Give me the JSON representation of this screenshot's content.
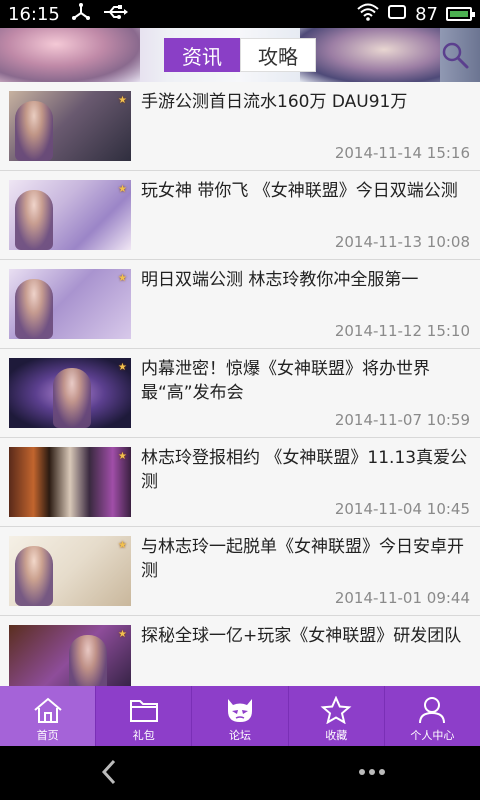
{
  "status_bar": {
    "time": "16:15",
    "battery": "87"
  },
  "header": {
    "tabs": [
      {
        "label": "资讯",
        "active": true
      },
      {
        "label": "攻略",
        "active": false
      }
    ],
    "search_icon": "search-icon"
  },
  "articles": [
    {
      "title": "手游公测首日流水160万 DAU91万",
      "date": "2014-11-14 15:16"
    },
    {
      "title": "玩女神 带你飞 《女神联盟》今日双端公测",
      "date": "2014-11-13 10:08"
    },
    {
      "title": "明日双端公测 林志玲教你冲全服第一",
      "date": "2014-11-12 15:10"
    },
    {
      "title": "内幕泄密！惊爆《女神联盟》将办世界最“高”发布会",
      "date": "2014-11-07 10:59"
    },
    {
      "title": "林志玲登报相约 《女神联盟》11.13真爱公测",
      "date": "2014-11-04 10:45"
    },
    {
      "title": "与林志玲一起脱单《女神联盟》今日安卓开测",
      "date": "2014-11-01 09:44"
    },
    {
      "title": "探秘全球一亿+玩家《女神联盟》研发团队",
      "date": ""
    }
  ],
  "bottom_nav": [
    {
      "label": "首页",
      "icon": "home-icon",
      "active": true
    },
    {
      "label": "礼包",
      "icon": "folder-icon",
      "active": false
    },
    {
      "label": "论坛",
      "icon": "mask-icon",
      "active": false
    },
    {
      "label": "收藏",
      "icon": "star-icon",
      "active": false
    },
    {
      "label": "个人中心",
      "icon": "person-icon",
      "active": false
    }
  ],
  "colors": {
    "accent": "#8d3ec9",
    "active_nav": "#a563d8",
    "date_text": "#8a8a8a"
  }
}
